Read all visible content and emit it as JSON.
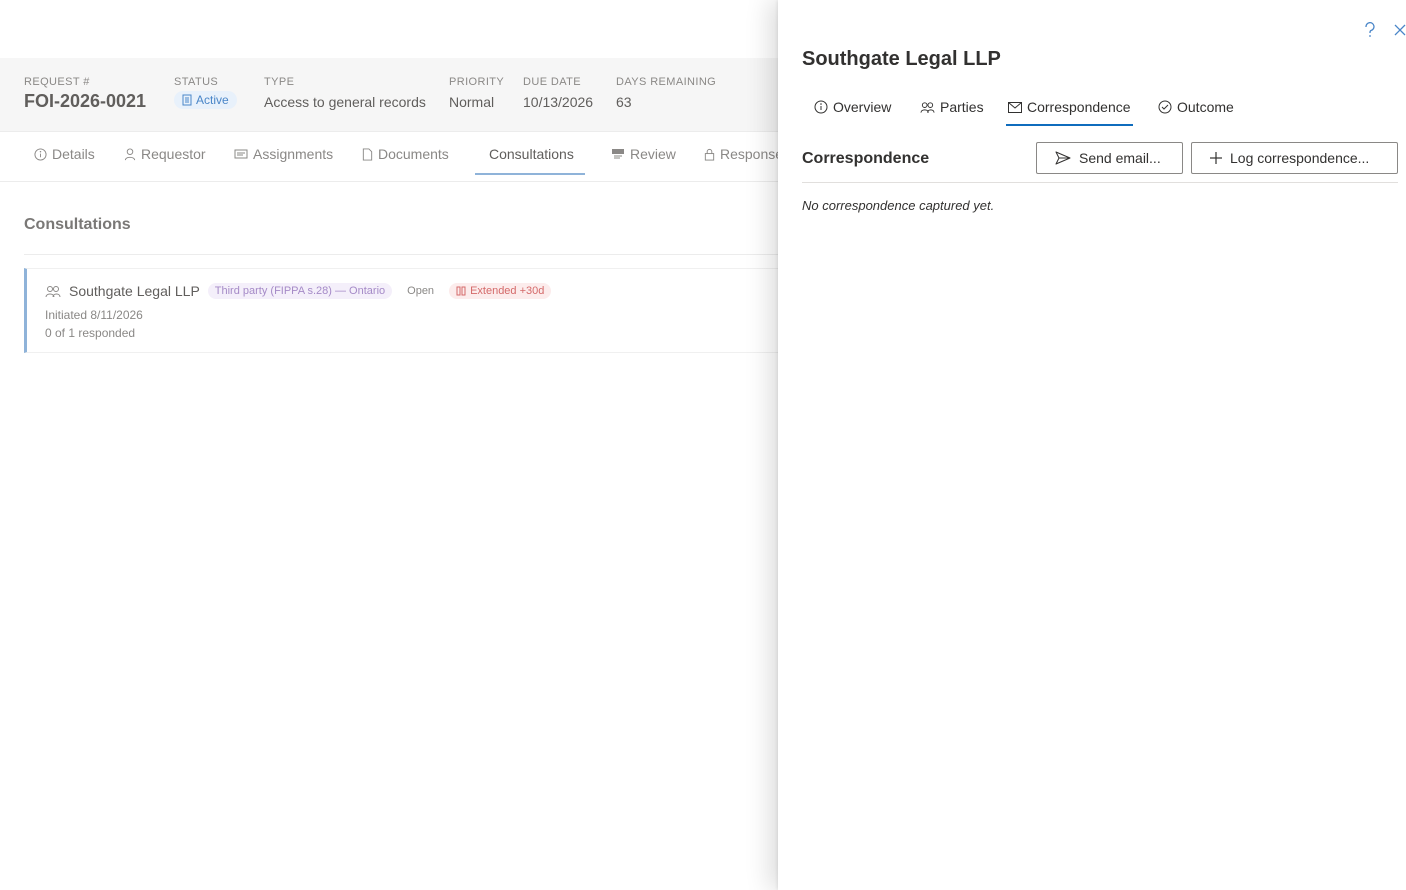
{
  "request_header": {
    "request_label": "REQUEST #",
    "request_value": "FOI-2026-0021",
    "status_label": "STATUS",
    "status_value": "Active",
    "type_label": "TYPE",
    "type_value": "Access to general records",
    "priority_label": "PRIORITY",
    "priority_value": "Normal",
    "due_label": "DUE DATE",
    "due_value": "10/13/2026",
    "days_label": "DAYS REMAINING",
    "days_value": "63"
  },
  "main_tabs": {
    "details": "Details",
    "requestor": "Requestor",
    "assignments": "Assignments",
    "documents": "Documents",
    "consultations": "Consultations",
    "review": "Review",
    "response": "Response"
  },
  "consultations": {
    "title": "Consultations",
    "card": {
      "name": "Southgate Legal LLP",
      "type_chip": "Third party (FIPPA s.28) — Ontario",
      "state": "Open",
      "extension": "Extended +30d",
      "initiated": "Initiated 8/11/2026",
      "responded": "0 of 1 responded"
    }
  },
  "panel": {
    "title": "Southgate Legal LLP",
    "tabs": {
      "overview": "Overview",
      "parties": "Parties",
      "correspondence": "Correspondence",
      "outcome": "Outcome"
    },
    "active_tab": "correspondence",
    "section_title": "Correspondence",
    "send_email_label": "Send email...",
    "log_label": "Log correspondence...",
    "empty_message": "No correspondence captured yet.",
    "help_icon": "question-icon",
    "close_icon": "close-icon"
  },
  "colors": {
    "accent": "#0f6cbd",
    "status_bg": "#e8f1fb",
    "extension_text": "#d46a6a",
    "chip_third_text": "#a58ac7"
  }
}
